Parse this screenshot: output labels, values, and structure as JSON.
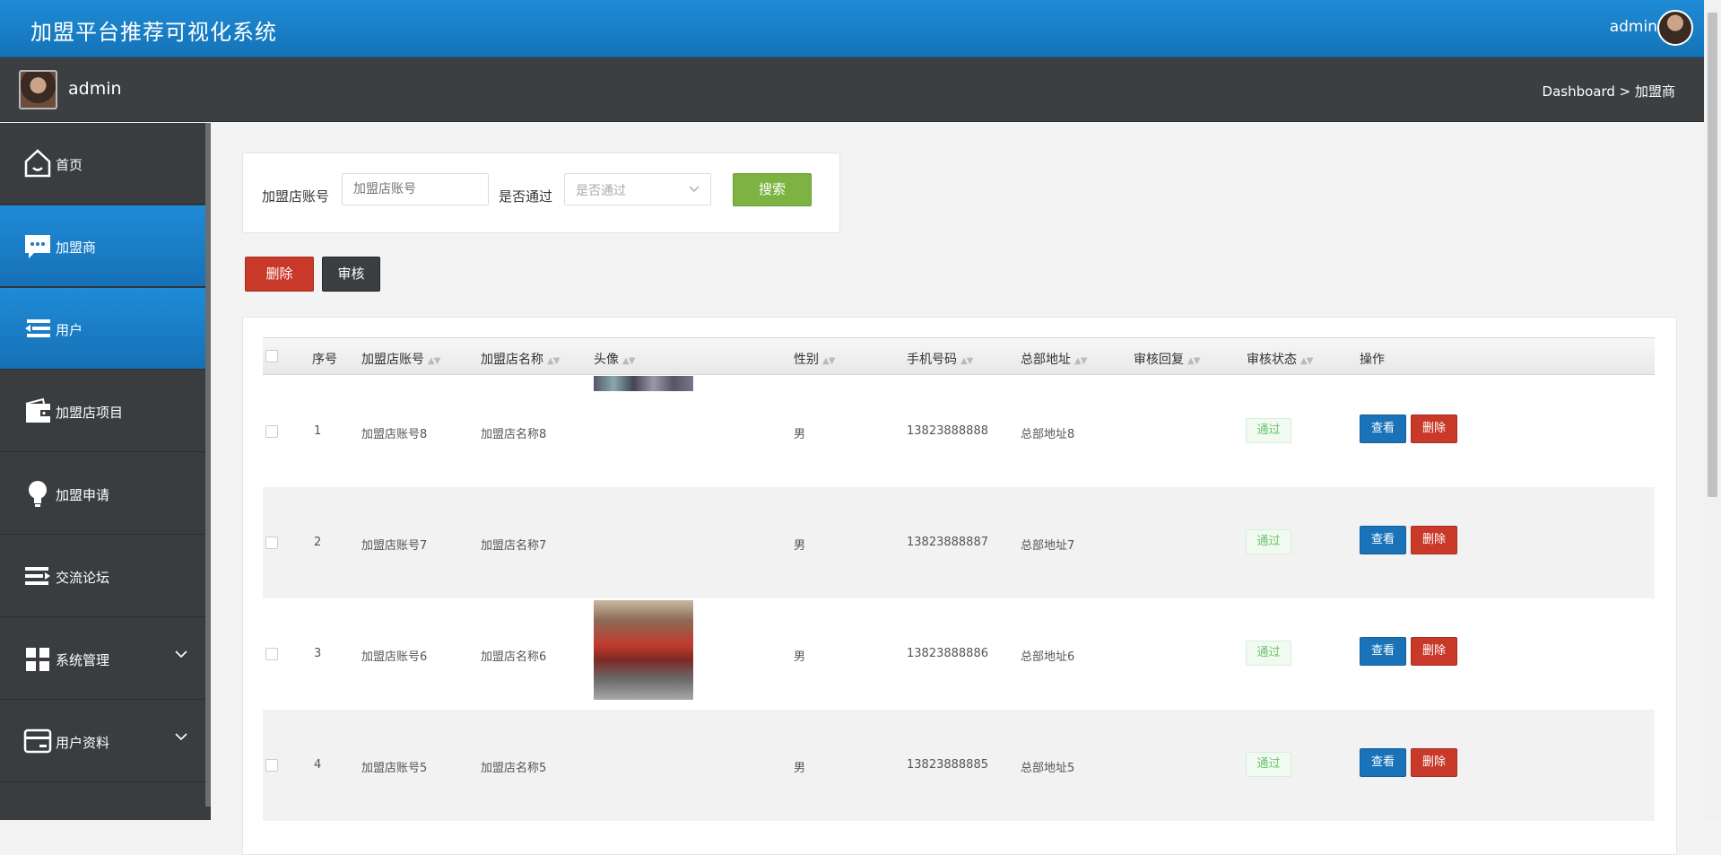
{
  "header": {
    "title": "加盟平台推荐可视化系统",
    "user": "admin"
  },
  "subbar": {
    "name": "admin",
    "breadcrumb": "Dashboard > 加盟商"
  },
  "sidebar": {
    "items": [
      {
        "label": "首页",
        "icon": "home-icon"
      },
      {
        "label": "加盟商",
        "icon": "chat-icon"
      },
      {
        "label": "用户",
        "icon": "list-icon"
      },
      {
        "label": "加盟店项目",
        "icon": "wallet-icon"
      },
      {
        "label": "加盟申请",
        "icon": "bulb-icon"
      },
      {
        "label": "交流论坛",
        "icon": "forum-icon"
      },
      {
        "label": "系统管理",
        "icon": "grid-icon"
      },
      {
        "label": "用户资料",
        "icon": "card-icon"
      }
    ]
  },
  "search": {
    "account_label": "加盟店账号",
    "account_placeholder": "加盟店账号",
    "pass_label": "是否通过",
    "pass_placeholder": "是否通过",
    "button": "搜索"
  },
  "actions": {
    "delete": "删除",
    "audit": "审核"
  },
  "table": {
    "headers": [
      "序号",
      "加盟店账号",
      "加盟店名称",
      "头像",
      "性别",
      "手机号码",
      "总部地址",
      "审核回复",
      "审核状态",
      "操作"
    ],
    "rows": [
      {
        "index": "1",
        "account": "加盟店账号8",
        "name": "加盟店名称8",
        "gender": "男",
        "phone": "13823888888",
        "address": "总部地址8",
        "reply": "",
        "status": "通过"
      },
      {
        "index": "2",
        "account": "加盟店账号7",
        "name": "加盟店名称7",
        "gender": "男",
        "phone": "13823888887",
        "address": "总部地址7",
        "reply": "",
        "status": "通过"
      },
      {
        "index": "3",
        "account": "加盟店账号6",
        "name": "加盟店名称6",
        "gender": "男",
        "phone": "13823888886",
        "address": "总部地址6",
        "reply": "",
        "status": "通过"
      },
      {
        "index": "4",
        "account": "加盟店账号5",
        "name": "加盟店名称5",
        "gender": "男",
        "phone": "13823888885",
        "address": "总部地址5",
        "reply": "",
        "status": "通过"
      }
    ],
    "view_label": "查看",
    "delete_label": "删除"
  },
  "colors": {
    "primary": "#1a73b8",
    "danger": "#c9392a",
    "success": "#7cb342",
    "sidebar": "#3a3d40"
  }
}
